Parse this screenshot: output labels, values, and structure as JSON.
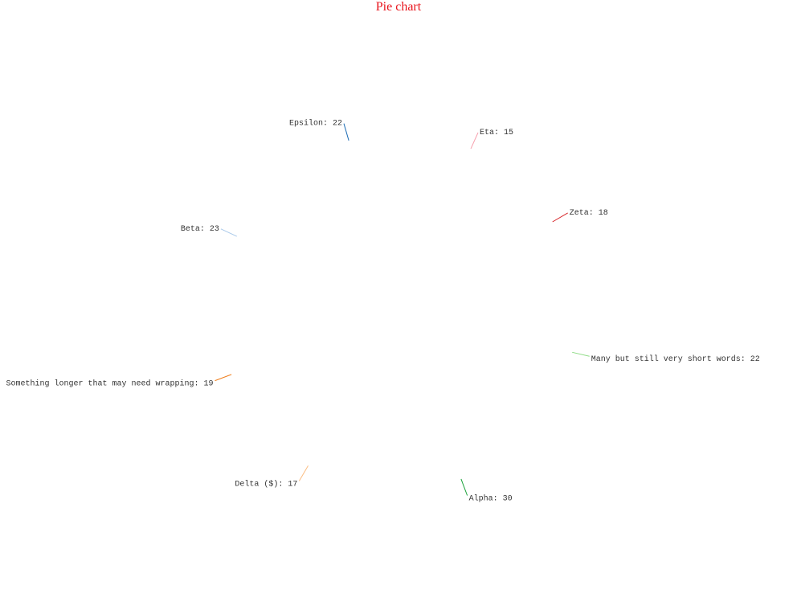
{
  "chart_data": {
    "type": "pie",
    "title": "Pie chart",
    "title_color": "#e8141c",
    "slices": [
      {
        "label": "Alpha",
        "value": 30,
        "color": "#1aa23a"
      },
      {
        "label": "Many but still very short words",
        "value": 22,
        "color": "#8fdc86"
      },
      {
        "label": "Zeta",
        "value": 18,
        "color": "#d7262a"
      },
      {
        "label": "Eta",
        "value": 15,
        "color": "#f7a0ae"
      },
      {
        "label": "Epsilon",
        "value": 22,
        "color": "#1f6eb5"
      },
      {
        "label": "Beta",
        "value": 23,
        "color": "#a9c9ea"
      },
      {
        "label": "Something longer that may need wrapping",
        "value": 19,
        "color": "#f07e1c"
      },
      {
        "label": "Delta ($)",
        "value": 17,
        "color": "#fbbd82"
      }
    ],
    "label_format": "{label}: {value}",
    "slice_fill": "none"
  }
}
